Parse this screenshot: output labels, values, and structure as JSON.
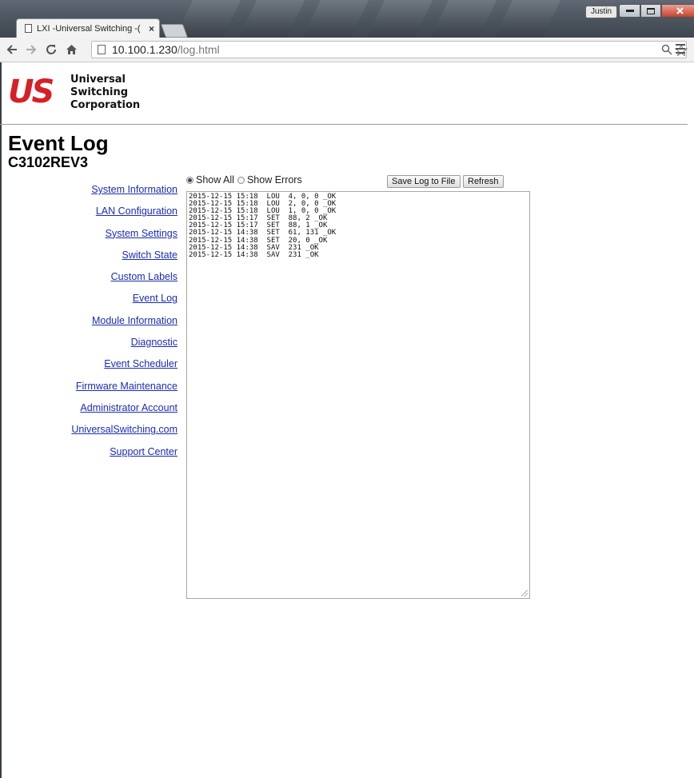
{
  "browser": {
    "tab_title": "LXI -Universal Switching -(",
    "tab_close": "×",
    "user": "Justin",
    "url_host": "10.100.1.230",
    "url_path": "/log.html"
  },
  "logo": {
    "mark": "US",
    "line1": "Universal",
    "line2": "Switching",
    "line3": "Corporation",
    "colors": {
      "mark": "#d61f26"
    }
  },
  "page": {
    "title": "Event Log",
    "subtitle": "C3102REV3"
  },
  "nav": {
    "items": [
      {
        "label": "System Information"
      },
      {
        "label": "LAN Configuration"
      },
      {
        "label": "System Settings"
      },
      {
        "label": "Switch State"
      },
      {
        "label": "Custom Labels"
      },
      {
        "label": "Event Log"
      },
      {
        "label": "Module Information"
      },
      {
        "label": "Diagnostic"
      },
      {
        "label": "Event Scheduler"
      },
      {
        "label": "Firmware Maintenance"
      },
      {
        "label": "Administrator Account"
      },
      {
        "label": "UniversalSwitching.com"
      },
      {
        "label": "Support Center"
      }
    ]
  },
  "log": {
    "filters": [
      {
        "label": "Show All",
        "selected": true
      },
      {
        "label": "Show Errors",
        "selected": false
      }
    ],
    "save_label": "Save Log to File",
    "refresh_label": "Refresh",
    "lines": [
      "2015-12-15 15:18  LOU  4, 0, 0 _OK",
      "2015-12-15 15:18  LOU  2, 0, 0 _OK",
      "2015-12-15 15:18  LOU  1, 0, 0 _OK",
      "2015-12-15 15:17  SET  88, 2 _OK",
      "2015-12-15 15:17  SET  88, 1 _OK",
      "2015-12-15 14:38  SET  61, 131 _OK",
      "2015-12-15 14:38  SET  20, 0 _OK",
      "2015-12-15 14:38  SAV  231 _OK",
      "2015-12-15 14:38  SAV  231 _OK"
    ]
  }
}
